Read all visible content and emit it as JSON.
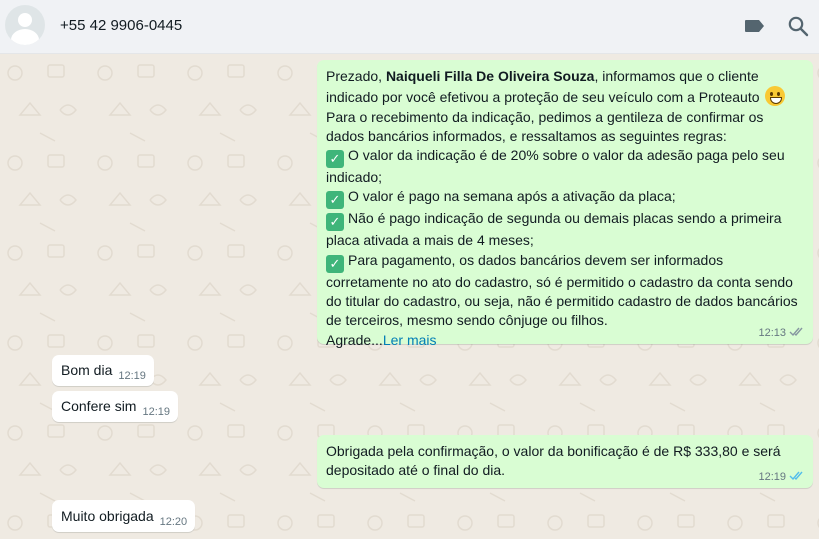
{
  "header": {
    "contact": "+55 42 9906-0445",
    "label_icon": "label-icon",
    "search_icon": "search-icon"
  },
  "messages": [
    {
      "direction": "out",
      "greeting": "Prezado, ",
      "name": "Naiqueli Filla De Oliveira Souza",
      "after_name": ", informamos que o cliente",
      "line2": "indicado por você efetivou a proteção de seu veículo com a Proteauto",
      "line3": "Para o recebimento da indicação, pedimos a gentileza de confirmar os",
      "line4": "dados bancários informados, e  ressaltamos as seguintes regras:",
      "rule1_a": "O valor da indicação é de 20% sobre o valor da adesão paga pelo seu",
      "rule1_b": "indicado;",
      "rule2": "O valor é pago na semana após a ativação da placa;",
      "rule3_a": "Não é pago indicação de segunda ou demais placas sendo a primeira",
      "rule3_b": "placa ativada a mais de 4 meses;",
      "rule4_a": "Para pagamento, os dados bancários devem ser informados",
      "rule4_b": "corretamente no ato do cadastro, só é permitido o cadastro da conta sendo",
      "rule4_c": "do titular do cadastro, ou seja, não é permitido cadastro de dados bancários",
      "rule4_d": "de terceiros, mesmo sendo cônjuge ou filhos.",
      "last": "Agrade...",
      "read_more": "Ler mais",
      "time": "12:13",
      "status": "delivered"
    },
    {
      "direction": "in",
      "text": "Bom dia",
      "time": "12:19"
    },
    {
      "direction": "in",
      "text": "Confere sim",
      "time": "12:19"
    },
    {
      "direction": "out",
      "line1": "Obrigada pela confirmação, o valor da bonificação é de R$ 333,80 e será",
      "line2": "depositado até o final do dia.",
      "time": "12:19",
      "status": "read"
    },
    {
      "direction": "in",
      "text": "Muito obrigada",
      "time": "12:20"
    }
  ],
  "colors": {
    "header_bg": "#f0f2f5",
    "chat_bg": "#efeae2",
    "outgoing_bubble": "#d9fdd3",
    "incoming_bubble": "#ffffff",
    "read_ticks": "#53bdeb",
    "delivered_ticks": "#8696a0",
    "link": "#027eb5"
  }
}
